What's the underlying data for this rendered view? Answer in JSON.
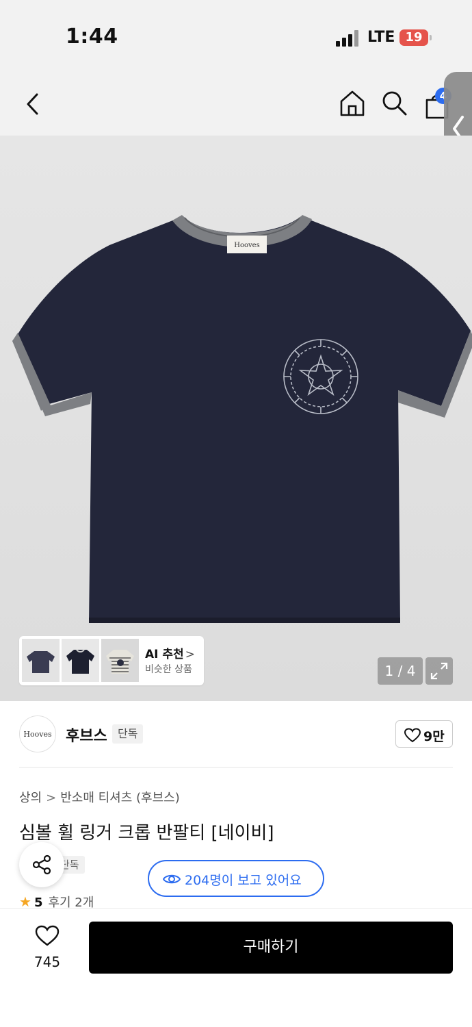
{
  "status_bar": {
    "time": "1:44",
    "network": "LTE",
    "battery": "19"
  },
  "nav": {
    "cart_count": "4"
  },
  "gallery": {
    "label_brand": "Hooves",
    "ai_title": "AI 추천",
    "ai_chevron": ">",
    "ai_subtitle": "비슷한 상품",
    "counter": "1 / 4"
  },
  "brand": {
    "logo_text": "Hooves",
    "name": "후브스",
    "tag": "단독",
    "likes": "9만"
  },
  "product": {
    "breadcrumb": [
      "상의",
      "반소매 티셔츠 (후브스)"
    ],
    "breadcrumb_sep": ">",
    "title": "심볼 휠 링거 크롭 반팔티 [네이비]",
    "tag": "단독",
    "viewers": "204명이 보고 있어요",
    "rating_star": "★",
    "rating": "5",
    "reviews": "후기 2개"
  },
  "bottom_bar": {
    "like_count": "745",
    "buy_label": "구매하기"
  },
  "colors": {
    "accent_blue": "#2c6cf0",
    "shirt_navy": "#23263a",
    "rib_gray": "#7d7f83",
    "star": "#f5a623",
    "buy_button": "#000000"
  }
}
